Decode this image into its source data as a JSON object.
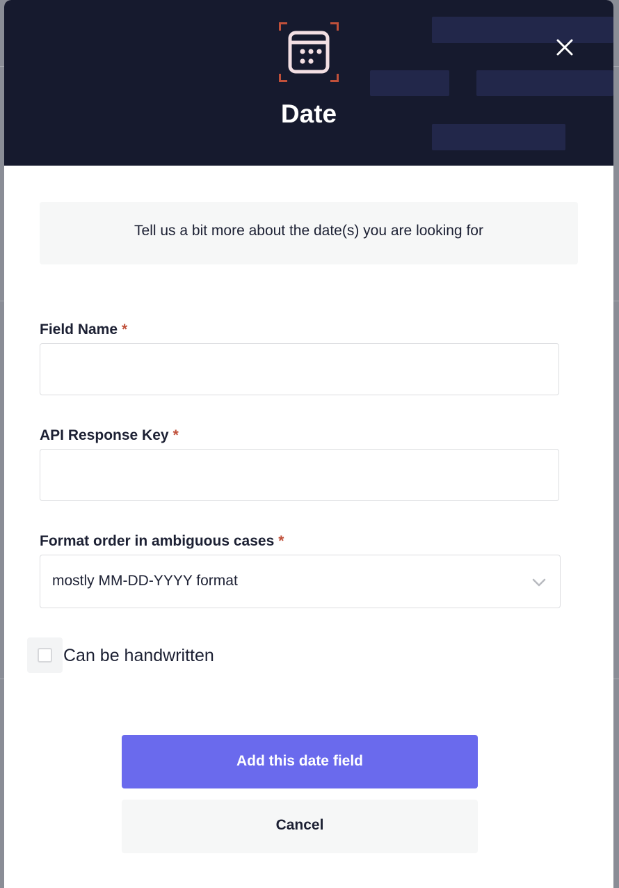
{
  "dialog": {
    "title": "Date",
    "icon": "calendar-icon",
    "close_icon": "close-icon",
    "intro_text": "Tell us a bit more about the date(s) you are looking for"
  },
  "form": {
    "field_name": {
      "label": "Field Name",
      "required_mark": "*",
      "value": ""
    },
    "api_response_key": {
      "label": "API Response Key",
      "required_mark": "*",
      "value": ""
    },
    "format_order": {
      "label": "Format order in ambiguous cases",
      "required_mark": "*",
      "selected": "mostly MM-DD-YYYY format"
    },
    "handwritten": {
      "label": "Can be handwritten",
      "checked": false
    }
  },
  "actions": {
    "primary_label": "Add this date field",
    "secondary_label": "Cancel"
  },
  "colors": {
    "header_bg": "#161a2e",
    "accent": "#6a6aed",
    "required": "#c0503a",
    "icon_bracket": "#c0503a"
  }
}
